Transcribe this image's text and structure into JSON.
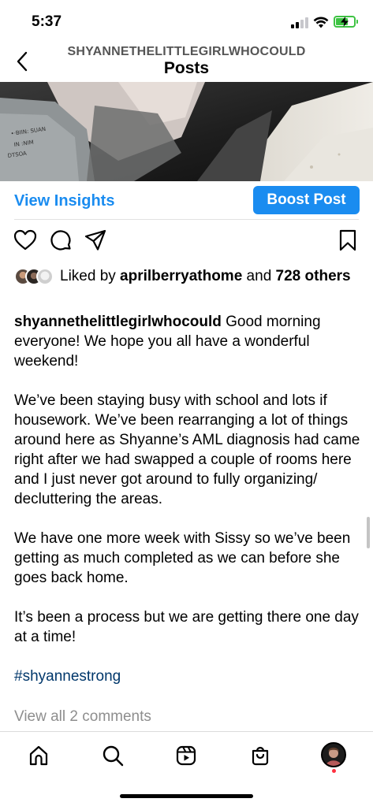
{
  "status_bar": {
    "time": "5:37",
    "signal_bars_active": 2,
    "battery_level": 0.7,
    "icons": [
      "signal-icon",
      "wifi-icon",
      "battery-charging-icon"
    ]
  },
  "header": {
    "username": "SHYANNETHELITTLEGIRLWHOCOULD",
    "title": "Posts",
    "back_icon": "chevron-left-icon"
  },
  "actions": {
    "view_insights": "View Insights",
    "boost_post": "Boost Post",
    "icons": [
      "heart-icon",
      "comment-icon",
      "share-icon",
      "bookmark-icon"
    ]
  },
  "likes": {
    "prefix": "Liked by ",
    "user": "aprilberryathome",
    "middle": " and ",
    "count": "728 others"
  },
  "caption": {
    "username": "shyannethelittlegirlwhocould",
    "paragraphs": [
      "Good morning everyone! We hope you all have a wonderful weekend!",
      "We’ve been staying busy with school and lots if housework. We’ve been rearranging a lot of things around here as Shyanne’s AML diagnosis had came right after we had swapped a couple of rooms here and I just never got around to fully organizing/ decluttering the areas.",
      "We have one more week with Sissy so we’ve been getting as much completed as we can before she goes back home.",
      "It’s been a process but we are getting there one day at a time!"
    ],
    "hashtag": "#shyannestrong"
  },
  "comments": {
    "view_all": "View all 2 comments"
  },
  "tab_bar": {
    "items": [
      "home-icon",
      "search-icon",
      "reels-icon",
      "shop-icon",
      "profile-avatar"
    ]
  },
  "colors": {
    "accent": "#1a8cf0",
    "hashtag": "#00376b",
    "battery": "#3ec343",
    "notification": "#ff3040"
  }
}
